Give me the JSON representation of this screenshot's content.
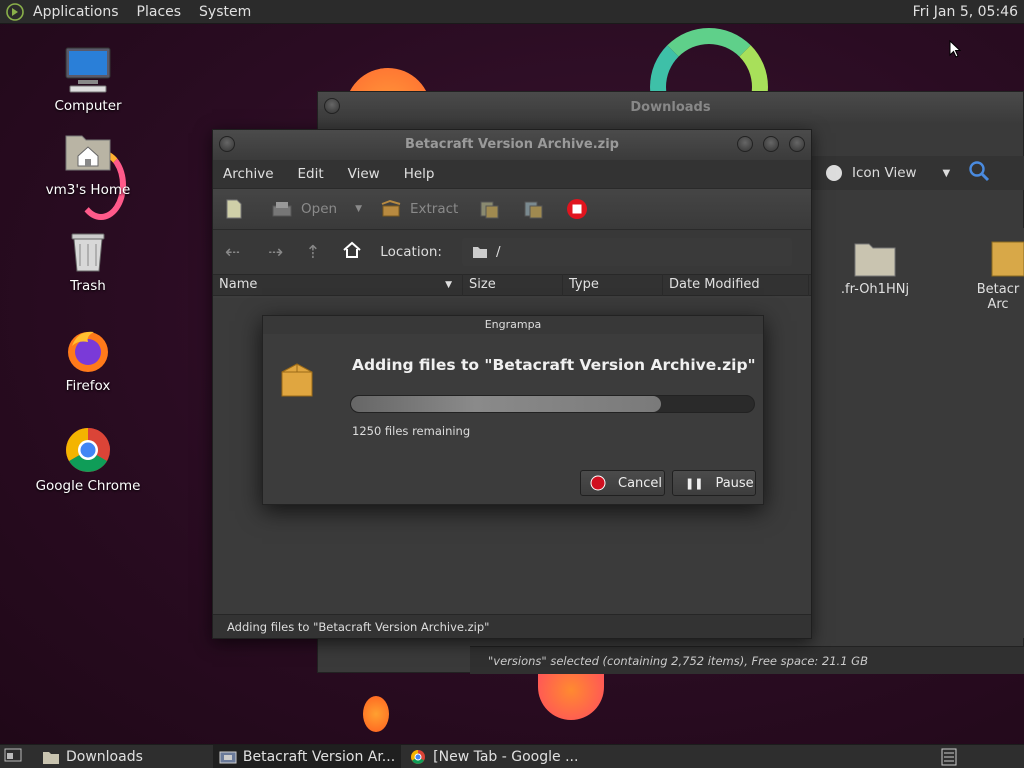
{
  "top_panel": {
    "menus": [
      "Applications",
      "Places",
      "System"
    ],
    "clock": "Fri Jan  5, 05:46"
  },
  "desktop_icons": [
    {
      "label": "Computer",
      "icon": "computer-icon"
    },
    {
      "label": "vm3's Home",
      "icon": "home-folder-icon"
    },
    {
      "label": "Trash",
      "icon": "trash-icon"
    },
    {
      "label": "Firefox",
      "icon": "firefox-icon"
    },
    {
      "label": "Google Chrome",
      "icon": "chrome-icon"
    }
  ],
  "downloads_window": {
    "title": "Downloads",
    "view_mode": "Icon View",
    "files": [
      ".fr-Oh1HNj",
      "Betacr Arc"
    ],
    "status": "\"versions\" selected (containing 2,752 items), Free space: 21.1 GB"
  },
  "engrampa_window": {
    "title": "Betacraft Version Archive.zip",
    "menus": [
      "Archive",
      "Edit",
      "View",
      "Help"
    ],
    "toolbar": {
      "open": "Open",
      "extract": "Extract"
    },
    "location_label": "Location:",
    "location_value": "/",
    "columns": [
      "Name",
      "Size",
      "Type",
      "Date Modified"
    ],
    "status": "Adding files to \"Betacraft Version Archive.zip\""
  },
  "progress_dialog": {
    "title": "Engrampa",
    "heading": "Adding files to \"Betacraft Version Archive.zip\"",
    "progress_fraction": 0.77,
    "remaining": "1250 files remaining",
    "cancel_label": "Cancel",
    "pause_label": "Pause"
  },
  "taskbar": {
    "tasks": [
      {
        "label": "Downloads",
        "icon": "folder-icon"
      },
      {
        "label": "Betacraft Version Ar...",
        "icon": "archive-manager-icon"
      },
      {
        "label": "[New Tab - Google ...",
        "icon": "chrome-icon"
      }
    ]
  },
  "colors": {
    "desktop_bg": "#2a0c22",
    "cancel_red": "#d01020",
    "stop_red": "#e0141e"
  }
}
